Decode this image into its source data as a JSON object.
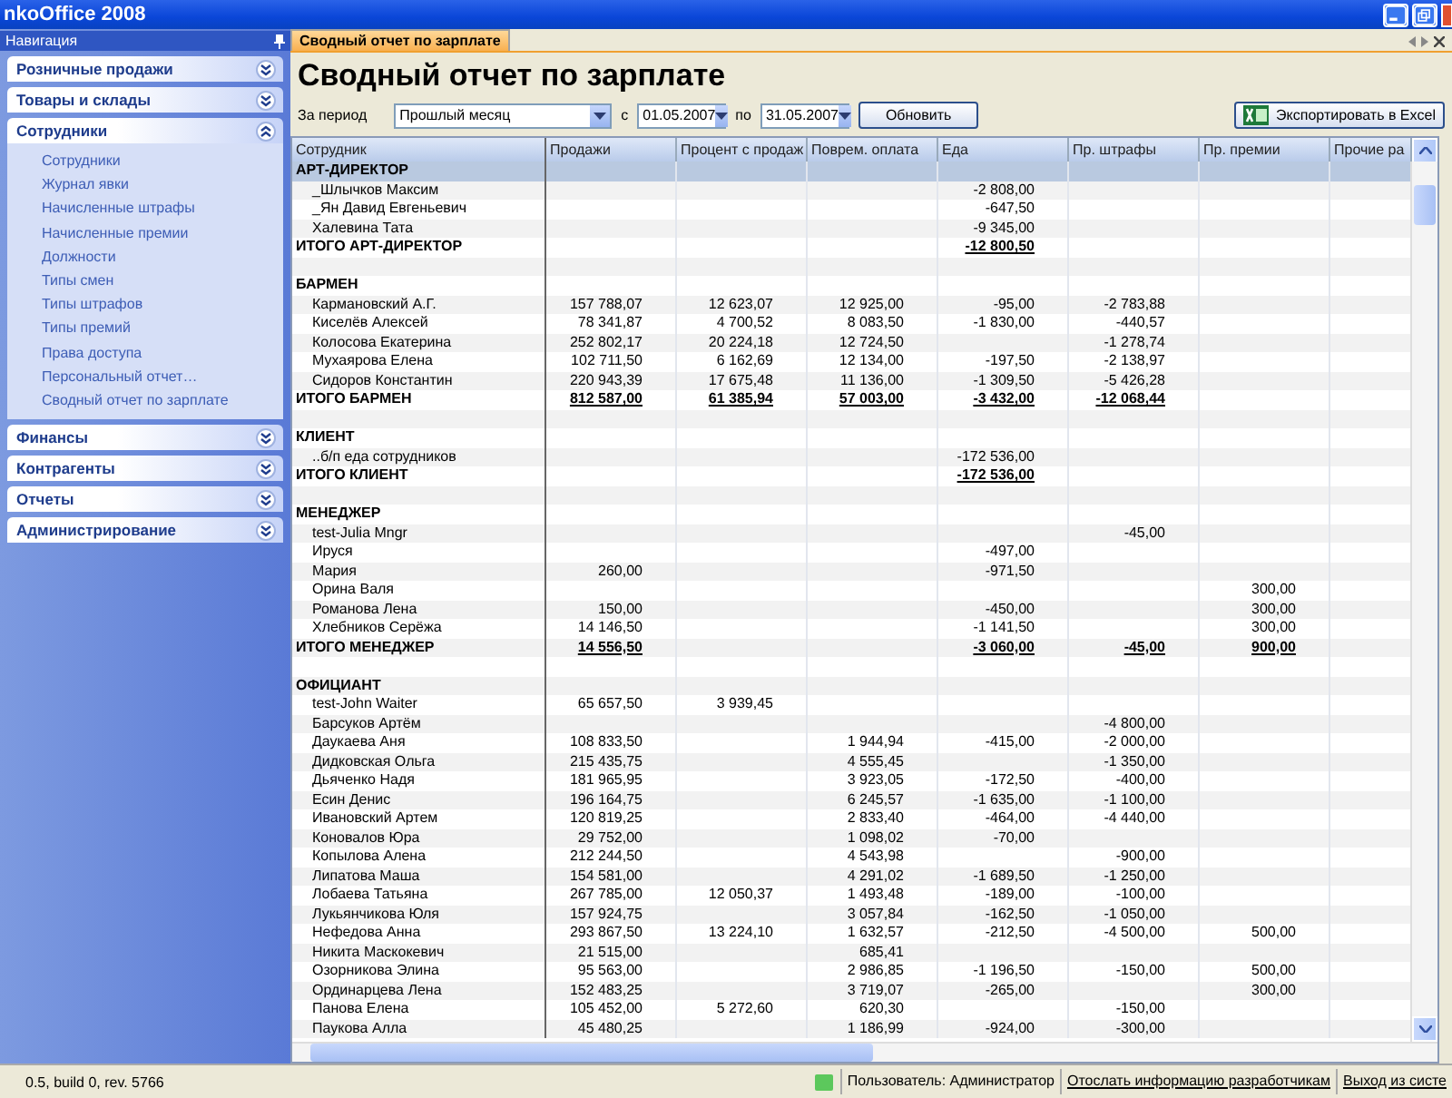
{
  "window": {
    "title": "nkoOffice 2008"
  },
  "navigation": {
    "title": "Навигация",
    "groups": [
      {
        "label": "Розничные продажи",
        "expanded": false
      },
      {
        "label": "Товары и склады",
        "expanded": false
      },
      {
        "label": "Сотрудники",
        "expanded": true,
        "items": [
          "Сотрудники",
          "Журнал явки",
          "Начисленные штрафы",
          "Начисленные премии",
          "Должности",
          "Типы смен",
          "Типы штрафов",
          "Типы премий",
          "Права доступа",
          "Персональный отчет…",
          "Сводный отчет по зарплате"
        ]
      },
      {
        "label": "Финансы",
        "expanded": false
      },
      {
        "label": "Контрагенты",
        "expanded": false
      },
      {
        "label": "Отчеты",
        "expanded": false
      },
      {
        "label": "Администрирование",
        "expanded": false
      }
    ]
  },
  "tabs": [
    {
      "label": "Сводный отчет по зарплате",
      "selected": true
    }
  ],
  "heading": "Сводный отчет по зарплате",
  "toolbar": {
    "period_label": "За период",
    "period": "Прошлый месяц",
    "from_label": "с",
    "from": "01.05.2007",
    "to_label": "по",
    "to": "31.05.2007",
    "refresh": "Обновить",
    "export": "Экспортировать в Excel"
  },
  "table": {
    "name_column": "Сотрудник",
    "columns": [
      {
        "label": "Продажи"
      },
      {
        "label": "Процент с продаж"
      },
      {
        "label": "Поврем. оплата"
      },
      {
        "label": "Еда"
      },
      {
        "label": "Пр. штрафы"
      },
      {
        "label": "Пр. премии"
      },
      {
        "label": "Прочие ра"
      }
    ],
    "rows": [
      {
        "kind": "group",
        "name": "АРТ-ДИРЕКТОР",
        "selected": true
      },
      {
        "kind": "item",
        "name": "_Шлычков Максим",
        "selected": false,
        "cells": {
          "food": "-2 808,00"
        }
      },
      {
        "kind": "item",
        "name": "_Ян Давид Евгеньевич",
        "selected": false,
        "cells": {
          "food": "-647,50"
        }
      },
      {
        "kind": "item",
        "name": "Халевина Тата",
        "selected": false,
        "cells": {
          "food": "-9 345,00"
        }
      },
      {
        "kind": "total",
        "name": "ИТОГО АРТ-ДИРЕКТОР",
        "selected": false,
        "cells": {
          "food": "-12 800,50"
        }
      },
      {
        "kind": "blank",
        "selected": false
      },
      {
        "kind": "group",
        "name": "БАРМЕН",
        "selected": false
      },
      {
        "kind": "item",
        "name": "Кармановский А.Г.",
        "selected": false,
        "cells": {
          "sales": "157 788,07",
          "percent": "12 623,07",
          "hourly": "12 925,00",
          "food": "-95,00",
          "fines": "-2 783,88"
        }
      },
      {
        "kind": "item",
        "name": "Киселёв Алексей",
        "selected": false,
        "cells": {
          "sales": "78 341,87",
          "percent": "4 700,52",
          "hourly": "8 083,50",
          "food": "-1 830,00",
          "fines": "-440,57"
        }
      },
      {
        "kind": "item",
        "name": "Колосова Екатерина",
        "selected": false,
        "cells": {
          "sales": "252 802,17",
          "percent": "20 224,18",
          "hourly": "12 724,50",
          "fines": "-1 278,74"
        }
      },
      {
        "kind": "item",
        "name": "Мухаярова Елена",
        "selected": false,
        "cells": {
          "sales": "102 711,50",
          "percent": "6 162,69",
          "hourly": "12 134,00",
          "food": "-197,50",
          "fines": "-2 138,97"
        }
      },
      {
        "kind": "item",
        "name": "Сидоров Константин",
        "selected": false,
        "cells": {
          "sales": "220 943,39",
          "percent": "17 675,48",
          "hourly": "11 136,00",
          "food": "-1 309,50",
          "fines": "-5 426,28"
        }
      },
      {
        "kind": "total",
        "name": "ИТОГО БАРМЕН",
        "selected": false,
        "cells": {
          "sales": "812 587,00",
          "percent": "61 385,94",
          "hourly": "57 003,00",
          "food": "-3 432,00",
          "fines": "-12 068,44"
        }
      },
      {
        "kind": "blank",
        "selected": false
      },
      {
        "kind": "group",
        "name": "КЛИЕНТ",
        "selected": false
      },
      {
        "kind": "item",
        "name": "..б/п еда сотрудников",
        "selected": false,
        "cells": {
          "food": "-172 536,00"
        }
      },
      {
        "kind": "total",
        "name": "ИТОГО КЛИЕНТ",
        "selected": false,
        "cells": {
          "food": "-172 536,00"
        }
      },
      {
        "kind": "blank",
        "selected": false
      },
      {
        "kind": "group",
        "name": "МЕНЕДЖЕР",
        "selected": false
      },
      {
        "kind": "item",
        "name": "test-Julia Mngr",
        "selected": false,
        "cells": {
          "fines": "-45,00"
        }
      },
      {
        "kind": "item",
        "name": "Ируся",
        "selected": false,
        "cells": {
          "food": "-497,00"
        }
      },
      {
        "kind": "item",
        "name": "Мария",
        "selected": false,
        "cells": {
          "sales": "260,00",
          "food": "-971,50"
        }
      },
      {
        "kind": "item",
        "name": "Орина Валя",
        "selected": false,
        "cells": {
          "bonuses": "300,00"
        }
      },
      {
        "kind": "item",
        "name": "Романова Лена",
        "selected": false,
        "cells": {
          "sales": "150,00",
          "food": "-450,00",
          "bonuses": "300,00"
        }
      },
      {
        "kind": "item",
        "name": "Хлебников Серёжа",
        "selected": false,
        "cells": {
          "sales": "14 146,50",
          "food": "-1 141,50",
          "bonuses": "300,00"
        }
      },
      {
        "kind": "total",
        "name": "ИТОГО МЕНЕДЖЕР",
        "selected": false,
        "cells": {
          "sales": "14 556,50",
          "food": "-3 060,00",
          "fines": "-45,00",
          "bonuses": "900,00"
        }
      },
      {
        "kind": "blank",
        "selected": false
      },
      {
        "kind": "group",
        "name": "ОФИЦИАНТ",
        "selected": false
      },
      {
        "kind": "item",
        "name": "test-John Waiter",
        "selected": false,
        "cells": {
          "sales": "65 657,50",
          "percent": "3 939,45"
        }
      },
      {
        "kind": "item",
        "name": "Барсуков Артём",
        "selected": false,
        "cells": {
          "fines": "-4 800,00"
        }
      },
      {
        "kind": "item",
        "name": "Даукаева Аня",
        "selected": false,
        "cells": {
          "sales": "108 833,50",
          "hourly": "1 944,94",
          "food": "-415,00",
          "fines": "-2 000,00"
        }
      },
      {
        "kind": "item",
        "name": "Дидковская Ольга",
        "selected": false,
        "cells": {
          "sales": "215 435,75",
          "hourly": "4 555,45",
          "fines": "-1 350,00"
        }
      },
      {
        "kind": "item",
        "name": "Дьяченко Надя",
        "selected": false,
        "cells": {
          "sales": "181 965,95",
          "hourly": "3 923,05",
          "food": "-172,50",
          "fines": "-400,00"
        }
      },
      {
        "kind": "item",
        "name": "Есин Денис",
        "selected": false,
        "cells": {
          "sales": "196 164,75",
          "hourly": "6 245,57",
          "food": "-1 635,00",
          "fines": "-1 100,00"
        }
      },
      {
        "kind": "item",
        "name": "Ивановский Артем",
        "selected": false,
        "cells": {
          "sales": "120 819,25",
          "hourly": "2 833,40",
          "food": "-464,00",
          "fines": "-4 440,00"
        }
      },
      {
        "kind": "item",
        "name": "Коновалов Юра",
        "selected": false,
        "cells": {
          "sales": "29 752,00",
          "hourly": "1 098,02",
          "food": "-70,00"
        }
      },
      {
        "kind": "item",
        "name": "Копылова Алена",
        "selected": false,
        "cells": {
          "sales": "212 244,50",
          "hourly": "4 543,98",
          "fines": "-900,00"
        }
      },
      {
        "kind": "item",
        "name": "Липатова Маша",
        "selected": false,
        "cells": {
          "sales": "154 581,00",
          "hourly": "4 291,02",
          "food": "-1 689,50",
          "fines": "-1 250,00"
        }
      },
      {
        "kind": "item",
        "name": "Лобаева Татьяна",
        "selected": false,
        "cells": {
          "sales": "267 785,00",
          "percent": "12 050,37",
          "hourly": "1 493,48",
          "food": "-189,00",
          "fines": "-100,00"
        }
      },
      {
        "kind": "item",
        "name": "Лукьянчикова Юля",
        "selected": false,
        "cells": {
          "sales": "157 924,75",
          "hourly": "3 057,84",
          "food": "-162,50",
          "fines": "-1 050,00"
        }
      },
      {
        "kind": "item",
        "name": "Нефедова Анна",
        "selected": false,
        "cells": {
          "sales": "293 867,50",
          "percent": "13 224,10",
          "hourly": "1 632,57",
          "food": "-212,50",
          "fines": "-4 500,00",
          "bonuses": "500,00"
        }
      },
      {
        "kind": "item",
        "name": "Никита Маскокевич",
        "selected": false,
        "cells": {
          "sales": "21 515,00",
          "hourly": "685,41"
        }
      },
      {
        "kind": "item",
        "name": "Озорникова Элина",
        "selected": false,
        "cells": {
          "sales": "95 563,00",
          "hourly": "2 986,85",
          "food": "-1 196,50",
          "fines": "-150,00",
          "bonuses": "500,00"
        }
      },
      {
        "kind": "item",
        "name": "Ординарцева Лена",
        "selected": false,
        "cells": {
          "sales": "152 483,25",
          "hourly": "3 719,07",
          "food": "-265,00",
          "bonuses": "300,00"
        }
      },
      {
        "kind": "item",
        "name": "Панова Елена",
        "selected": false,
        "cells": {
          "sales": "105 452,00",
          "percent": "5 272,60",
          "hourly": "620,30",
          "fines": "-150,00"
        }
      },
      {
        "kind": "item",
        "name": "Паукова Алла",
        "selected": false,
        "cells": {
          "sales": "45 480,25",
          "hourly": "1 186,99",
          "food": "-924,00",
          "fines": "-300,00"
        }
      }
    ]
  },
  "status_bar": {
    "version": "0.5, build 0, rev. 5766",
    "user": "Пользователь: Администратор",
    "links": [
      "Отослать информацию разработчикам",
      "Выход из систе"
    ]
  }
}
